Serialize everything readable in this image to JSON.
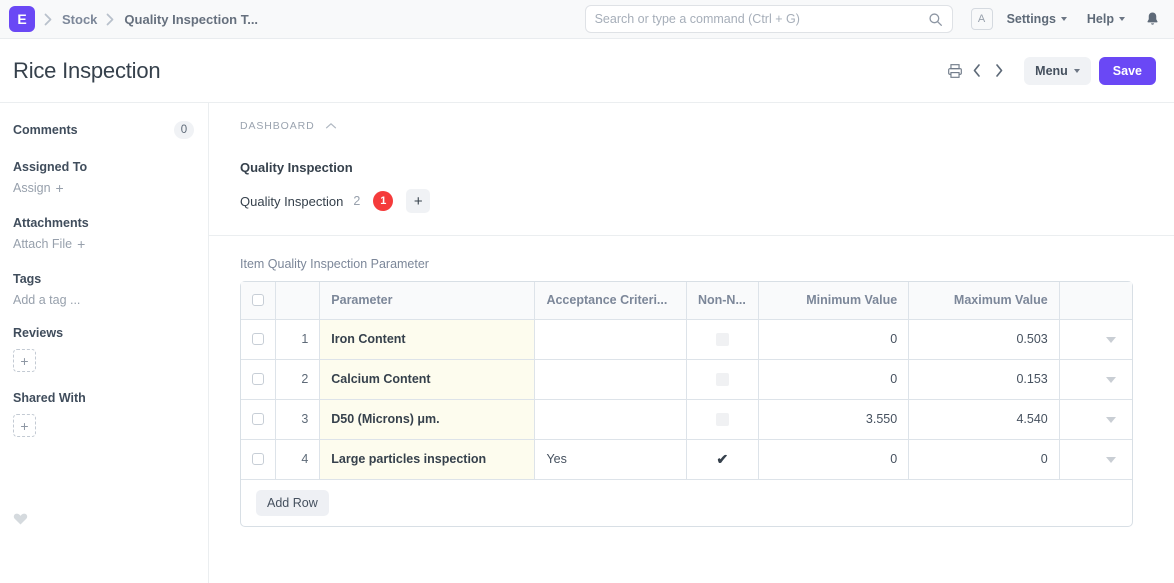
{
  "navbar": {
    "logo_text": "E",
    "breadcrumbs": [
      {
        "label": "Stock"
      },
      {
        "label": "Quality Inspection T..."
      }
    ],
    "search": {
      "value": "",
      "placeholder": "Search or type a command (Ctrl + G)"
    },
    "avatar_initial": "A",
    "settings_label": "Settings",
    "help_label": "Help"
  },
  "page": {
    "title": "Rice Inspection",
    "menu_label": "Menu",
    "save_label": "Save"
  },
  "sidebar": {
    "comments_label": "Comments",
    "comments_count": "0",
    "assigned_to_label": "Assigned To",
    "assign_label": "Assign",
    "attachments_label": "Attachments",
    "attach_file_label": "Attach File",
    "tags_label": "Tags",
    "add_tag_label": "Add a tag ...",
    "reviews_label": "Reviews",
    "shared_with_label": "Shared With",
    "plus_label": "+"
  },
  "dashboard": {
    "section_label": "DASHBOARD",
    "title": "Quality Inspection",
    "link_label": "Quality Inspection",
    "count": "2",
    "badge": "1",
    "add_label": "+"
  },
  "grid": {
    "label": "Item Quality Inspection Parameter",
    "columns": [
      {
        "key": "parameter",
        "label": "Parameter"
      },
      {
        "key": "acceptance",
        "label": "Acceptance Criteri..."
      },
      {
        "key": "nonnegative",
        "label": "Non-N..."
      },
      {
        "key": "minimum",
        "label": "Minimum Value"
      },
      {
        "key": "maximum",
        "label": "Maximum Value"
      }
    ],
    "rows": [
      {
        "idx": "1",
        "parameter": "Iron Content",
        "acceptance": "",
        "nonnegative": false,
        "minimum": "0",
        "maximum": "0.503"
      },
      {
        "idx": "2",
        "parameter": "Calcium Content",
        "acceptance": "",
        "nonnegative": false,
        "minimum": "0",
        "maximum": "0.153"
      },
      {
        "idx": "3",
        "parameter": "D50 (Microns) μm.",
        "acceptance": "",
        "nonnegative": false,
        "minimum": "3.550",
        "maximum": "4.540"
      },
      {
        "idx": "4",
        "parameter": "Large particles inspection",
        "acceptance": "Yes",
        "nonnegative": true,
        "minimum": "0",
        "maximum": "0"
      }
    ],
    "add_row_label": "Add Row",
    "tick_glyph": "✔"
  },
  "colors": {
    "brand_purple": "#6a48f5",
    "badge_red": "#f53b3b",
    "param_cell_bg": "#fdfcee"
  }
}
